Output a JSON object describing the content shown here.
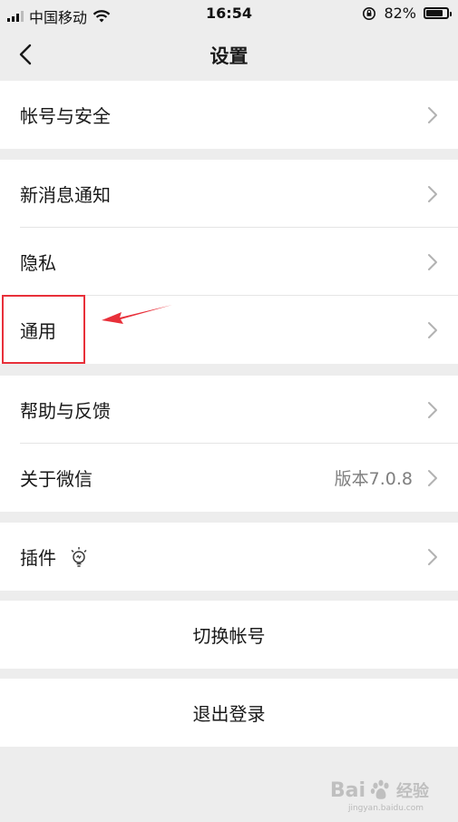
{
  "status_bar": {
    "carrier": "中国移动",
    "time": "16:54",
    "battery_percent": "82%",
    "battery_level": 0.82
  },
  "nav": {
    "title": "设置",
    "back_icon": "chevron-left-icon"
  },
  "groups": [
    {
      "items": [
        {
          "label": "帐号与安全"
        }
      ]
    },
    {
      "items": [
        {
          "label": "新消息通知"
        },
        {
          "label": "隐私"
        },
        {
          "label": "通用"
        }
      ]
    },
    {
      "items": [
        {
          "label": "帮助与反馈"
        },
        {
          "label": "关于微信",
          "value": "版本7.0.8"
        }
      ]
    },
    {
      "items": [
        {
          "label": "插件",
          "icon": "plugin-bulb-icon"
        }
      ]
    },
    {
      "items": [
        {
          "label": "切换帐号"
        }
      ]
    },
    {
      "items": [
        {
          "label": "退出登录"
        }
      ]
    }
  ],
  "annotation": {
    "highlight_color": "#e8303a",
    "highlighted_item": "通用"
  },
  "watermark": {
    "text": "Bai",
    "suffix": "经验",
    "sub": "jingyan.baidu.com"
  }
}
